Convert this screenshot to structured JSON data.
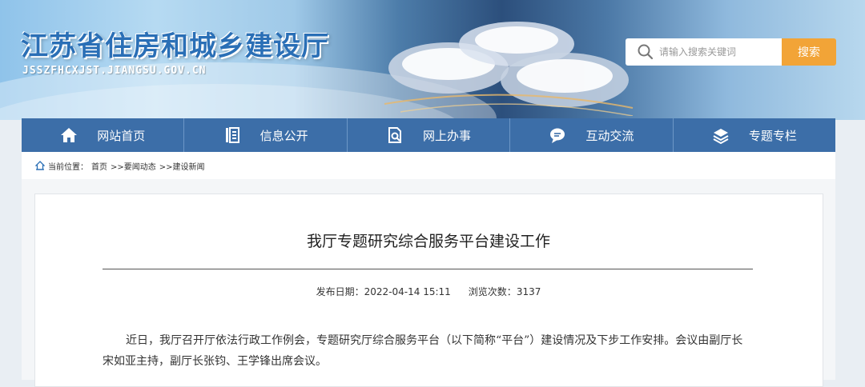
{
  "header": {
    "site_title": "江苏省住房和城乡建设厅",
    "site_domain": "JSSZFHCXJST.JIANGSU.GOV.CN",
    "search_placeholder": "请输入搜索关键词",
    "search_button": "搜索"
  },
  "nav": {
    "items": [
      {
        "label": "网站首页",
        "icon": "home-icon"
      },
      {
        "label": "信息公开",
        "icon": "document-list-icon"
      },
      {
        "label": "网上办事",
        "icon": "office-search-icon"
      },
      {
        "label": "互动交流",
        "icon": "chat-bubble-icon"
      },
      {
        "label": "专题专栏",
        "icon": "layers-icon"
      }
    ]
  },
  "breadcrumb": {
    "prefix": "当前位置：",
    "items": [
      "首页",
      ">>要闻动态",
      ">>建设新闻"
    ]
  },
  "article": {
    "title": "我厅专题研究综合服务平台建设工作",
    "publish_label": "发布日期：",
    "publish_date": "2022-04-14 15:11",
    "views_label": "浏览次数：",
    "views_count": "3137",
    "body": "近日，我厅召开厅依法行政工作例会，专题研究厅综合服务平台（以下简称“平台”）建设情况及下步工作安排。会议由副厅长宋如亚主持，副厅长张钧、王学锋出席会议。"
  },
  "colors": {
    "nav_bg": "#3c6ea8",
    "search_button_bg": "#f2a437",
    "title_blue": "#2a6fb6"
  }
}
